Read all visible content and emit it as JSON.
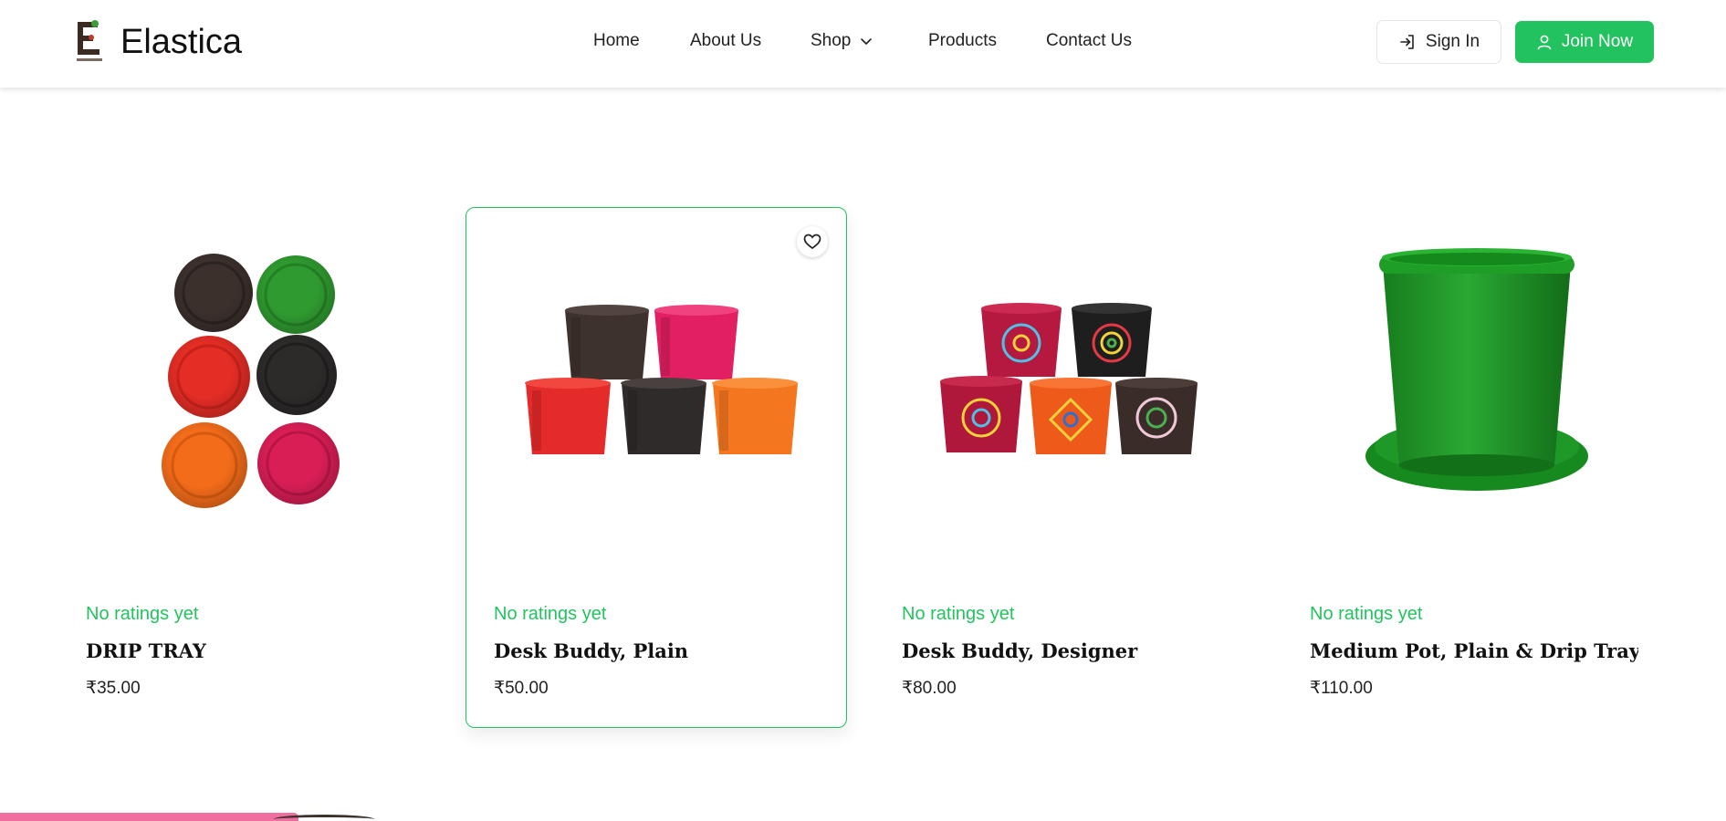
{
  "header": {
    "brand": "Elastica",
    "logo_letter": "E",
    "nav": [
      {
        "label": "Home"
      },
      {
        "label": "About Us"
      },
      {
        "label": "Shop",
        "has_dropdown": true
      },
      {
        "label": "Products"
      },
      {
        "label": "Contact Us"
      }
    ],
    "sign_in_label": "Sign In",
    "join_label": "Join Now",
    "icons": {
      "sign_in": "login-arrow-icon",
      "join": "user-icon",
      "shop_dropdown": "chevron-down-icon"
    }
  },
  "colors": {
    "accent": "#22c35e",
    "toast": "#f06e9f"
  },
  "products": [
    {
      "rating_text": "No ratings yet",
      "name": "DRIP TRAY",
      "price": "₹35.00",
      "image": "drip-trays-six-colors"
    },
    {
      "rating_text": "No ratings yet",
      "name": "Desk Buddy, Plain",
      "price": "₹50.00",
      "image": "plain-pots-five-colors",
      "hovered": true
    },
    {
      "rating_text": "No ratings yet",
      "name": "Desk Buddy, Designer",
      "price": "₹80.00",
      "image": "designer-pots-five"
    },
    {
      "rating_text": "No ratings yet",
      "name": "Medium Pot, Plain & Drip Tray Set",
      "price": "₹110.00",
      "image": "green-pot-with-tray"
    }
  ]
}
